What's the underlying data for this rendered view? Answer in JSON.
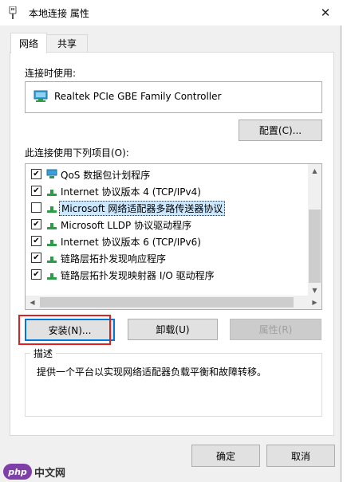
{
  "window": {
    "title": "本地连接 属性"
  },
  "tabs": [
    {
      "label": "网络"
    },
    {
      "label": "共享"
    }
  ],
  "connect_using": {
    "label": "连接时使用:",
    "adapter": "Realtek PCIe GBE Family Controller",
    "configure_button": "配置(C)..."
  },
  "items_section": {
    "label": "此连接使用下列项目(O):",
    "items": [
      {
        "label": "QoS 数据包计划程序",
        "checked": true
      },
      {
        "label": "Internet 协议版本 4 (TCP/IPv4)",
        "checked": true
      },
      {
        "label": "Microsoft 网络适配器多路传送器协议",
        "checked": false,
        "selected": true
      },
      {
        "label": "Microsoft LLDP 协议驱动程序",
        "checked": true
      },
      {
        "label": "Internet 协议版本 6 (TCP/IPv6)",
        "checked": true
      },
      {
        "label": "链路层拓扑发现响应程序",
        "checked": true
      },
      {
        "label": "链路层拓扑发现映射器 I/O 驱动程序",
        "checked": true
      }
    ]
  },
  "actions": {
    "install": "安装(N)...",
    "uninstall": "卸载(U)",
    "properties": "属性(R)"
  },
  "description": {
    "title": "描述",
    "text": "提供一个平台以实现网络适配器负载平衡和故障转移。"
  },
  "footer": {
    "ok": "确定",
    "cancel": "取消"
  },
  "watermark": {
    "text": "中文网",
    "logo": "php"
  },
  "colors": {
    "selection": "#cce8ff",
    "focus_border": "#0078d7",
    "highlight_box": "#e02020"
  }
}
